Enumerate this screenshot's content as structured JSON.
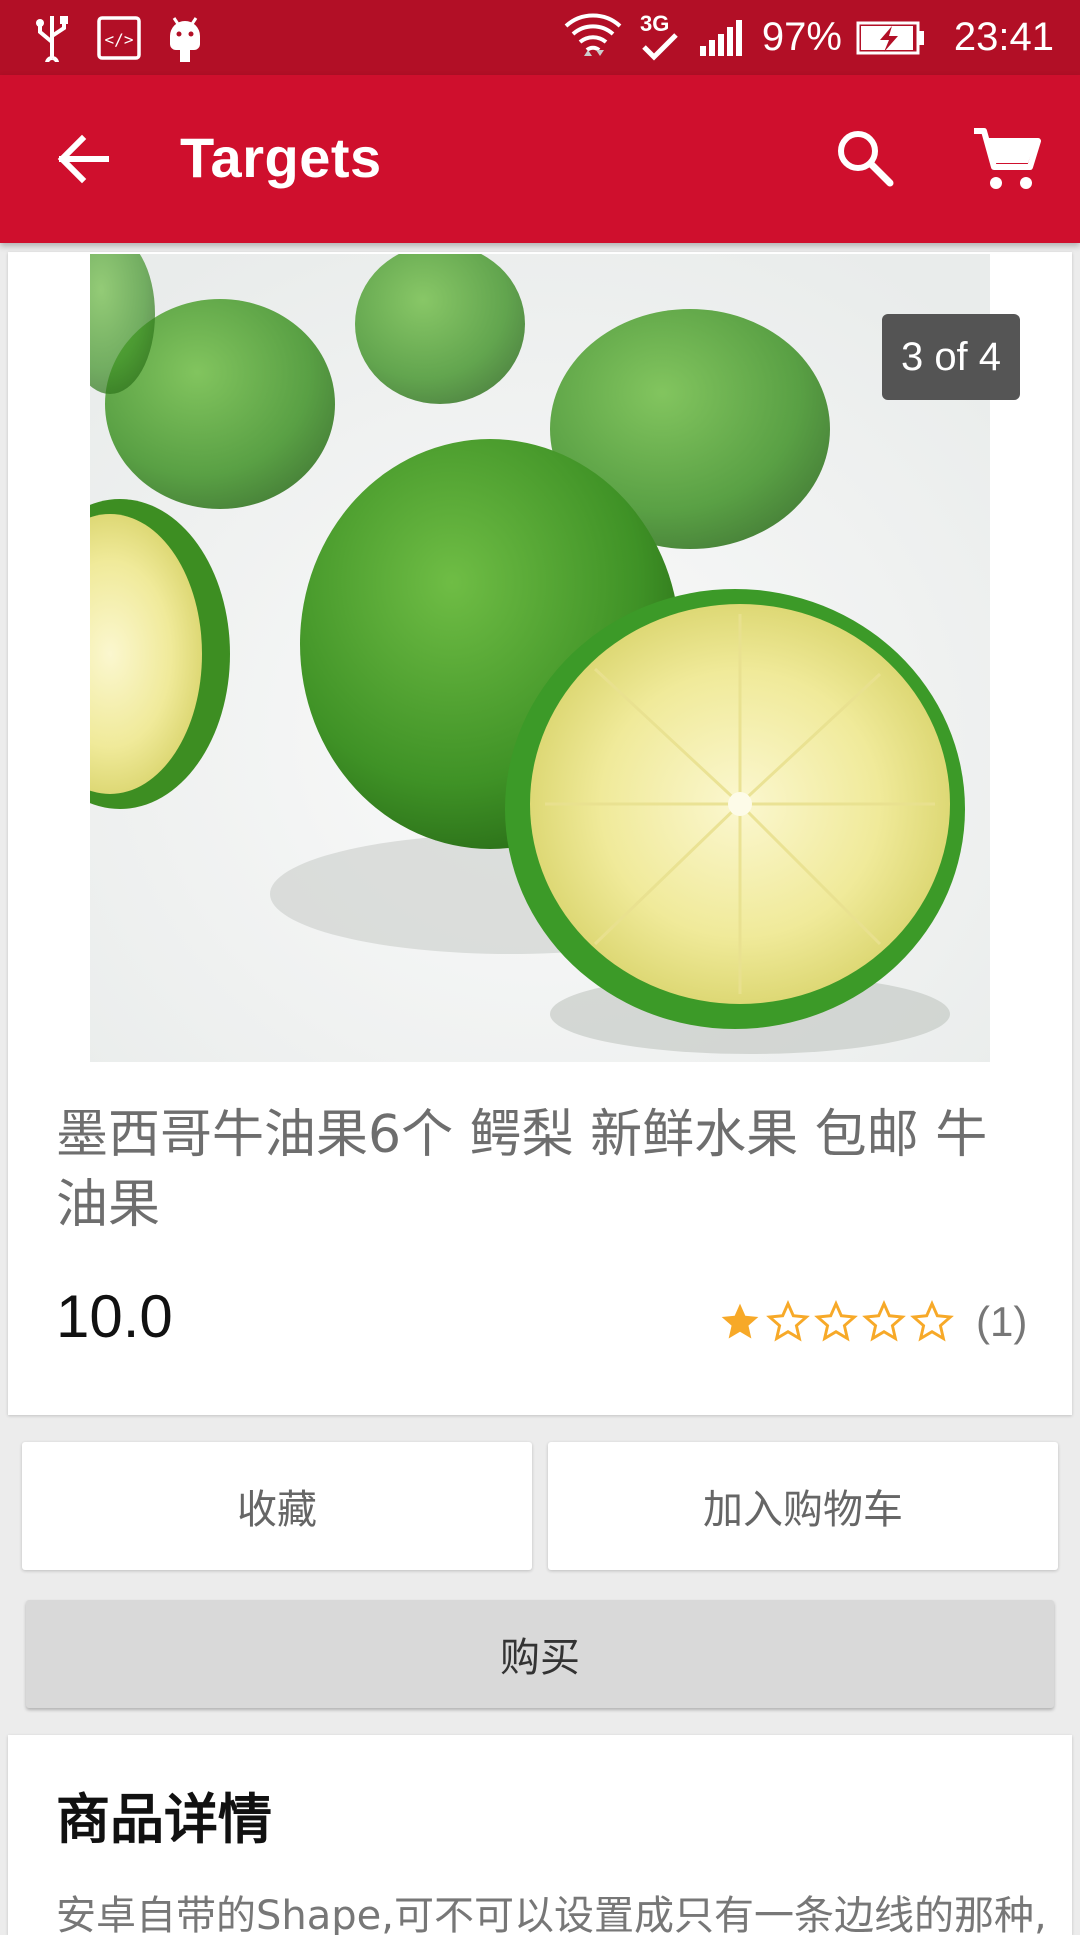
{
  "status_bar": {
    "battery": "97%",
    "time": "23:41",
    "network": "3G",
    "icons": [
      "usb-icon",
      "dev-code-icon",
      "android-icon",
      "wifi-icon",
      "3g-icon",
      "signal-icon",
      "battery-charging-icon"
    ]
  },
  "app_bar": {
    "title": "Targets",
    "icons": [
      "back-arrow-icon",
      "search-icon",
      "cart-icon"
    ],
    "color": "#cf0f2d"
  },
  "product": {
    "image_counter": "3 of 4",
    "title": "墨西哥牛油果6个 鳄梨 新鲜水果 包邮 牛油果",
    "price": "10.0",
    "rating_stars_filled": 1,
    "rating_stars_total": 5,
    "rating_count": "(1)"
  },
  "actions": {
    "favorite_label": "收藏",
    "add_to_cart_label": "加入购物车",
    "buy_label": "购买"
  },
  "details": {
    "heading": "商品详情",
    "text": "安卓自带的Shape,可不可以设置成只有一条边线的那种,"
  },
  "colors": {
    "status_bar": "#b20f26",
    "app_bar": "#cf0f2d",
    "star": "#f7a928"
  }
}
